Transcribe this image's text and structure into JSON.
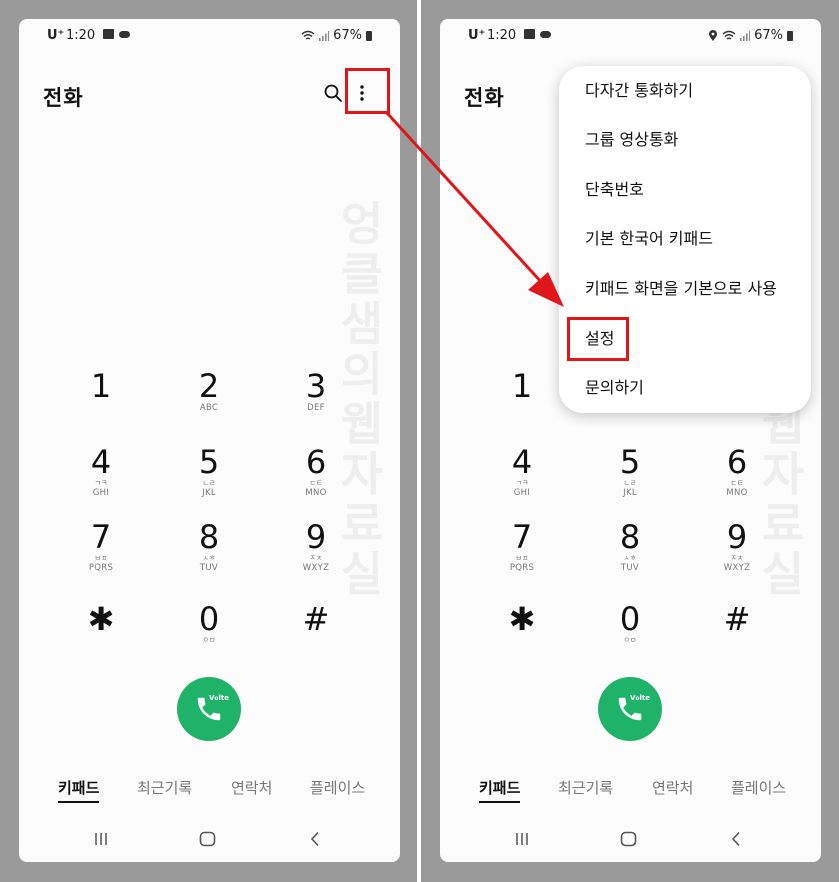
{
  "status_bar": {
    "carrier": "U⁺",
    "time": "1:20",
    "battery": "67%"
  },
  "header": {
    "title": "전화"
  },
  "keypad": [
    {
      "digit": "1",
      "korean": "",
      "letters": ""
    },
    {
      "digit": "2",
      "korean": "",
      "letters": "ABC"
    },
    {
      "digit": "3",
      "korean": "",
      "letters": "DEF"
    },
    {
      "digit": "4",
      "korean": "ㄱㅋ",
      "letters": "GHI"
    },
    {
      "digit": "5",
      "korean": "ㄴㄹ",
      "letters": "JKL"
    },
    {
      "digit": "6",
      "korean": "ㄷㅌ",
      "letters": "MNO"
    },
    {
      "digit": "7",
      "korean": "ㅂㅍ",
      "letters": "PQRS"
    },
    {
      "digit": "8",
      "korean": "ㅅㅎ",
      "letters": "TUV"
    },
    {
      "digit": "9",
      "korean": "ㅈㅊ",
      "letters": "WXYZ"
    },
    {
      "digit": "✱",
      "korean": "",
      "letters": ""
    },
    {
      "digit": "0",
      "korean": "ㅇㅁ",
      "letters": ""
    },
    {
      "digit": "#",
      "korean": "",
      "letters": ""
    }
  ],
  "call_button": {
    "badge": "VoLTE"
  },
  "tabs": [
    {
      "label": "키패드",
      "active": true
    },
    {
      "label": "최근기록",
      "active": false
    },
    {
      "label": "연락처",
      "active": false
    },
    {
      "label": "플레이스",
      "active": false
    }
  ],
  "overflow_menu": {
    "items": [
      "다자간 통화하기",
      "그룹 영상통화",
      "단축번호",
      "기본 한국어 키패드",
      "키패드 화면을 기본으로 사용",
      "설정",
      "문의하기"
    ]
  },
  "watermark": "엉클샘의웹자료실",
  "colors": {
    "accent_green": "#1fb36a",
    "highlight_red": "#e0161b",
    "background_gray": "#9a9a9a"
  },
  "icons": [
    "search-icon",
    "more-vertical-icon",
    "phone-icon",
    "recent-apps-icon",
    "home-icon",
    "back-icon",
    "wifi-icon",
    "signal-icon",
    "battery-icon",
    "location-icon",
    "gallery-icon",
    "cloud-icon"
  ]
}
